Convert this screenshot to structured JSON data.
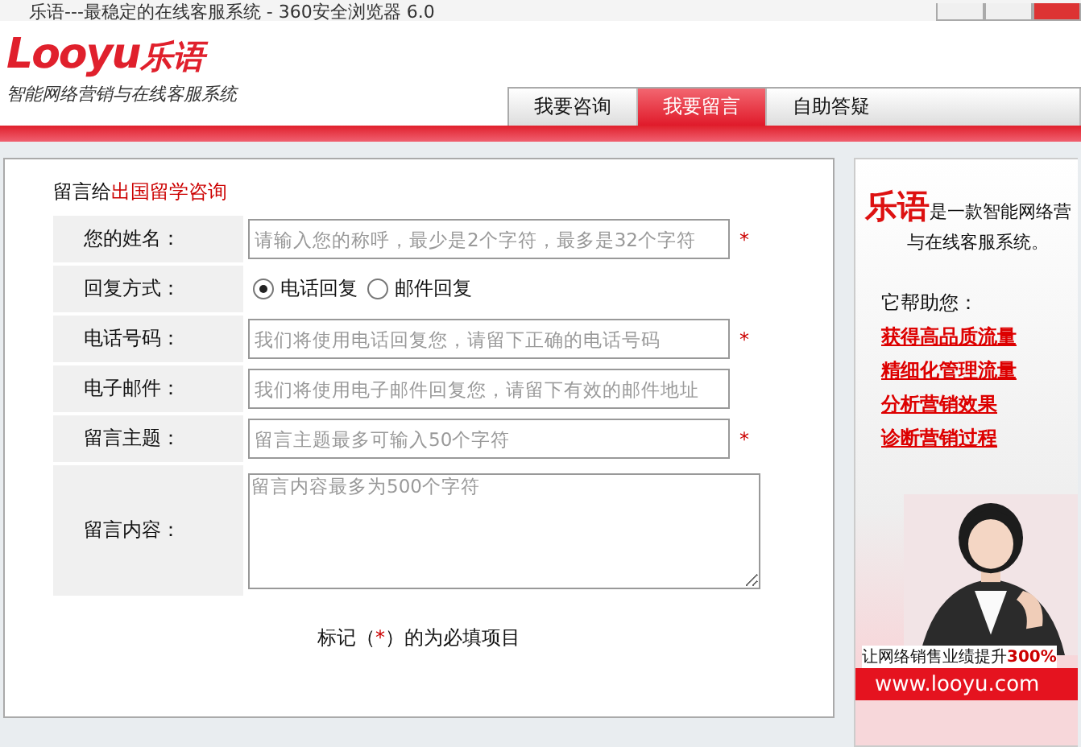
{
  "window": {
    "title": "乐语---最稳定的在线客服系统 - 360安全浏览器 6.0"
  },
  "header": {
    "logo_latin": "Looyu",
    "logo_cjk": "乐语",
    "tagline": "智能网络营销与在线客服系统"
  },
  "tabs": [
    {
      "label": "我要咨询",
      "selected": false
    },
    {
      "label": "我要留言",
      "selected": true
    },
    {
      "label": "自助答疑",
      "selected": false
    }
  ],
  "form": {
    "intro": "留言给",
    "recipient": "出国留学咨询",
    "rows": [
      {
        "kind": "input",
        "label": "您的姓名：",
        "placeholder": "请输入您的称呼，最少是2个字符，最多是32个字符",
        "required": true
      },
      {
        "kind": "radio",
        "label": "回复方式：",
        "options": [
          {
            "label": "电话回复",
            "selected": true
          },
          {
            "label": "邮件回复",
            "selected": false
          }
        ]
      },
      {
        "kind": "input",
        "label": "电话号码：",
        "placeholder": "我们将使用电话回复您，请留下正确的电话号码",
        "required": true
      },
      {
        "kind": "input",
        "label": "电子邮件：",
        "placeholder": "我们将使用电子邮件回复您，请留下有效的邮件地址",
        "required": false
      },
      {
        "kind": "input",
        "label": "留言主题：",
        "placeholder": "留言主题最多可输入50个字符",
        "required": true
      },
      {
        "kind": "textarea",
        "label": "留言内容：",
        "placeholder": "留言内容最多为500个字符"
      }
    ],
    "note_before": "标记（",
    "note_mark": "*",
    "note_after": "）的为必填项目"
  },
  "ad": {
    "brand": "乐语",
    "intro_1": "是一款智能网络营",
    "intro_2": "与在线客服系统。",
    "help_title": "它帮助您：",
    "benefits": [
      "获得高品质流量",
      "精细化管理流量",
      "分析营销效果",
      "诊断营销过程"
    ],
    "slogan": "让网络销售业绩提升",
    "slogan_figure": "300%",
    "url": "www.looyu.com"
  }
}
